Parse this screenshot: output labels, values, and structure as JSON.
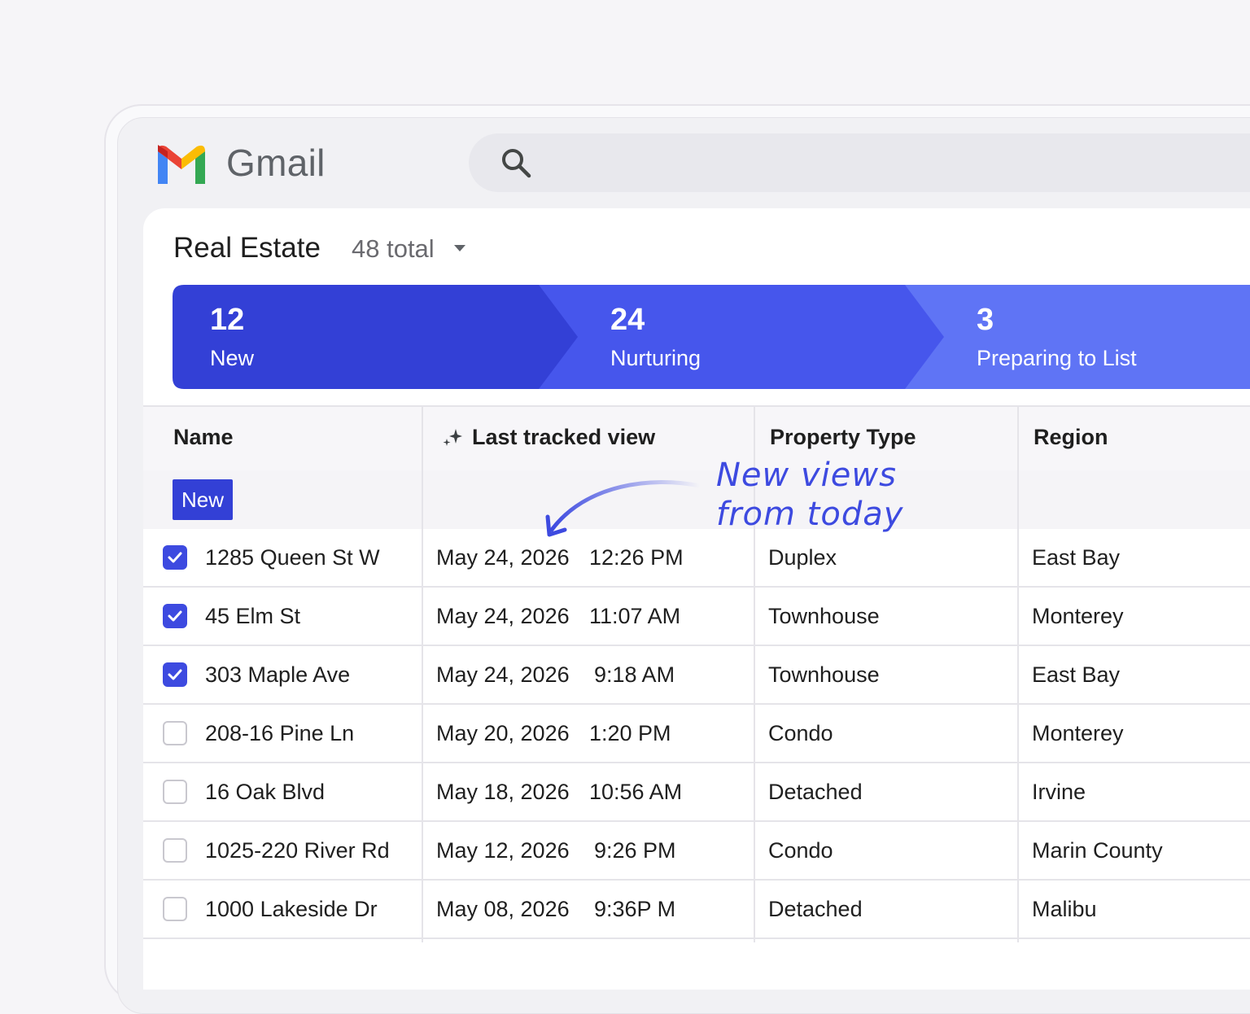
{
  "app": {
    "name": "Gmail"
  },
  "panel": {
    "title": "Real Estate",
    "count": "48 total"
  },
  "pipeline": [
    {
      "count": "12",
      "label": "New"
    },
    {
      "count": "24",
      "label": "Nurturing"
    },
    {
      "count": "3",
      "label": "Preparing to List"
    }
  ],
  "columns": [
    "Name",
    "Last tracked view",
    "Property Type",
    "Region"
  ],
  "group": {
    "label": "New"
  },
  "annotation": {
    "line1": "New views",
    "line2": "from today"
  },
  "rows": [
    {
      "checked": true,
      "name": "1285 Queen St W",
      "date": "May 24, 2026",
      "time": "12:26 PM",
      "type": "Duplex",
      "region": "East Bay"
    },
    {
      "checked": true,
      "name": "45 Elm St",
      "date": "May 24, 2026",
      "time": "11:07 AM",
      "type": "Townhouse",
      "region": "Monterey"
    },
    {
      "checked": true,
      "name": "303 Maple Ave",
      "date": "May 24, 2026",
      "time": "9:18 AM",
      "type": "Townhouse",
      "region": "East Bay"
    },
    {
      "checked": false,
      "name": "208-16 Pine Ln",
      "date": "May 20, 2026",
      "time": "1:20 PM",
      "type": "Condo",
      "region": "Monterey"
    },
    {
      "checked": false,
      "name": "16 Oak Blvd",
      "date": "May 18, 2026",
      "time": "10:56 AM",
      "type": "Detached",
      "region": "Irvine"
    },
    {
      "checked": false,
      "name": "1025-220 River Rd",
      "date": "May 12, 2026",
      "time": "9:26 PM",
      "type": "Condo",
      "region": "Marin County"
    },
    {
      "checked": false,
      "name": "1000 Lakeside Dr",
      "date": "May 08, 2026",
      "time": "9:36P M",
      "type": "Detached",
      "region": "Malibu"
    }
  ],
  "colors": {
    "stage_new": "#3340d6",
    "stage_nurturing": "#4656ec",
    "stage_preparing": "#5f74f5",
    "checkbox_on": "#3d4ae0",
    "annotation": "#3d4ae0"
  }
}
